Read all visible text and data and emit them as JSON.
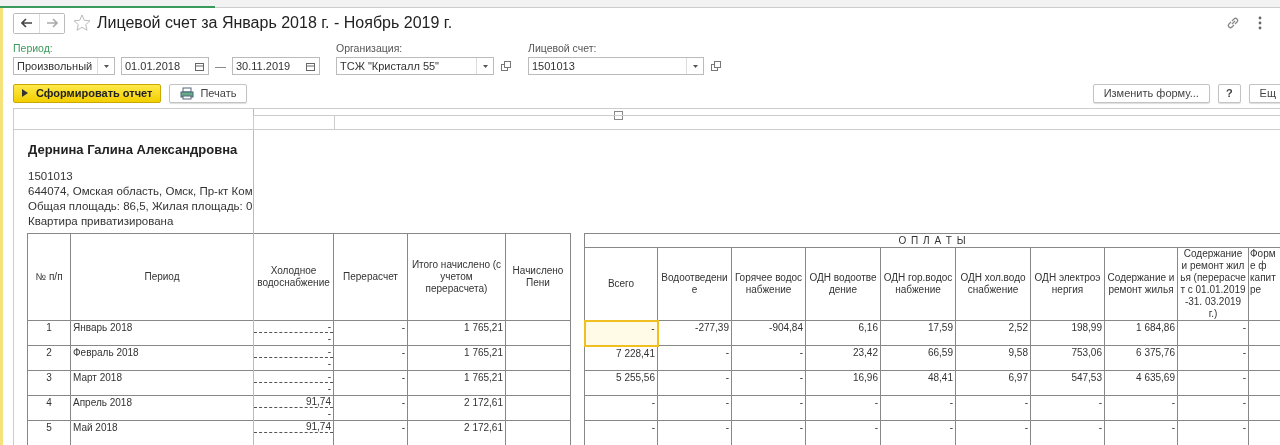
{
  "title": "Лицевой счет за Январь 2018 г. - Ноябрь 2019 г.",
  "filters": {
    "period": {
      "label": "Период:",
      "mode": "Произвольный",
      "from": "01.01.2018",
      "separator": "—",
      "to": "30.11.2019"
    },
    "organization": {
      "label": "Организация:",
      "value": "ТСЖ \"Кристалл 55\""
    },
    "account": {
      "label": "Лицевой счет:",
      "value": "1501013"
    }
  },
  "toolbar": {
    "generate": "Сформировать отчет",
    "print": "Печать",
    "change_form": "Изменить форму...",
    "help": "?",
    "more": "Ещ"
  },
  "report": {
    "owner": "Дернина Галина Александровна",
    "info_lines": [
      "1501013",
      "644074, Омская область, Омск, Пр-кт Ком",
      "Общая площадь: 86,5, Жилая площадь: 0",
      "Квартира приватизирована"
    ],
    "columns": [
      "№ п/п",
      "Период",
      "Холодное водоснабжение",
      "Перерасчет",
      "Итого начислено (с учетом перерасчета)",
      "Начислено Пени"
    ],
    "payments_group": "О П Л А Т Ы",
    "payment_columns": [
      "Всего",
      "Водоотведение",
      "Горячее водоснабжение",
      "ОДН водоотведение",
      "ОДН гор.водоснабжение",
      "ОДН хол.водоснабжение",
      "ОДН электроэнергия",
      "Содержание и ремонт жилья",
      "Содержание и ремонт жилья (перерасчет с 01.01.2019-31. 03.2019 г.)",
      "Форм е ф капит ре"
    ],
    "rows": [
      {
        "number": "1",
        "period": "Январь 2018",
        "cold_water": [
          "-",
          "-"
        ],
        "recalc": "-",
        "total": "1 765,21",
        "payments": [
          {
            "text": "-",
            "selected": true
          },
          {
            "text": "-277,39",
            "selected": false
          },
          {
            "text": "-904,84",
            "selected": false
          },
          {
            "text": "6,16",
            "selected": false
          },
          {
            "text": "17,59",
            "selected": false
          },
          {
            "text": "2,52",
            "selected": false
          },
          {
            "text": "198,99",
            "selected": false
          },
          {
            "text": "1 684,86",
            "selected": false
          },
          {
            "text": "-",
            "selected": false
          }
        ]
      },
      {
        "number": "2",
        "period": "Февраль 2018",
        "cold_water": [
          "-",
          "-"
        ],
        "recalc": "-",
        "total": "1 765,21",
        "payments": [
          {
            "text": "7 228,41",
            "selected": false
          },
          {
            "text": "-",
            "selected": false
          },
          {
            "text": "-",
            "selected": false
          },
          {
            "text": "23,42",
            "selected": false
          },
          {
            "text": "66,59",
            "selected": false
          },
          {
            "text": "9,58",
            "selected": false
          },
          {
            "text": "753,06",
            "selected": false
          },
          {
            "text": "6 375,76",
            "selected": false
          },
          {
            "text": "-",
            "selected": false
          }
        ]
      },
      {
        "number": "3",
        "period": "Март 2018",
        "cold_water": [
          "-",
          "-"
        ],
        "recalc": "-",
        "total": "1 765,21",
        "payments": [
          {
            "text": "5 255,56",
            "selected": false
          },
          {
            "text": "-",
            "selected": false
          },
          {
            "text": "-",
            "selected": false
          },
          {
            "text": "16,96",
            "selected": false
          },
          {
            "text": "48,41",
            "selected": false
          },
          {
            "text": "6,97",
            "selected": false
          },
          {
            "text": "547,53",
            "selected": false
          },
          {
            "text": "4 635,69",
            "selected": false
          },
          {
            "text": "-",
            "selected": false
          }
        ]
      },
      {
        "number": "4",
        "period": "Апрель 2018",
        "cold_water": [
          "91,74",
          "-"
        ],
        "recalc": "-",
        "total": "2 172,61",
        "payments": [
          {
            "text": "-",
            "selected": false
          },
          {
            "text": "-",
            "selected": false
          },
          {
            "text": "-",
            "selected": false
          },
          {
            "text": "-",
            "selected": false
          },
          {
            "text": "-",
            "selected": false
          },
          {
            "text": "-",
            "selected": false
          },
          {
            "text": "-",
            "selected": false
          },
          {
            "text": "-",
            "selected": false
          },
          {
            "text": "-",
            "selected": false
          }
        ]
      },
      {
        "number": "5",
        "period": "Май 2018",
        "cold_water": [
          "91,74"
        ],
        "recalc": "-",
        "total": "2 172,61",
        "payments": [
          {
            "text": "-",
            "selected": false
          },
          {
            "text": "-",
            "selected": false
          },
          {
            "text": "-",
            "selected": false
          },
          {
            "text": "-",
            "selected": false
          },
          {
            "text": "-",
            "selected": false
          },
          {
            "text": "-",
            "selected": false
          },
          {
            "text": "-",
            "selected": false
          },
          {
            "text": "-",
            "selected": false
          },
          {
            "text": "-",
            "selected": false
          }
        ]
      }
    ]
  }
}
